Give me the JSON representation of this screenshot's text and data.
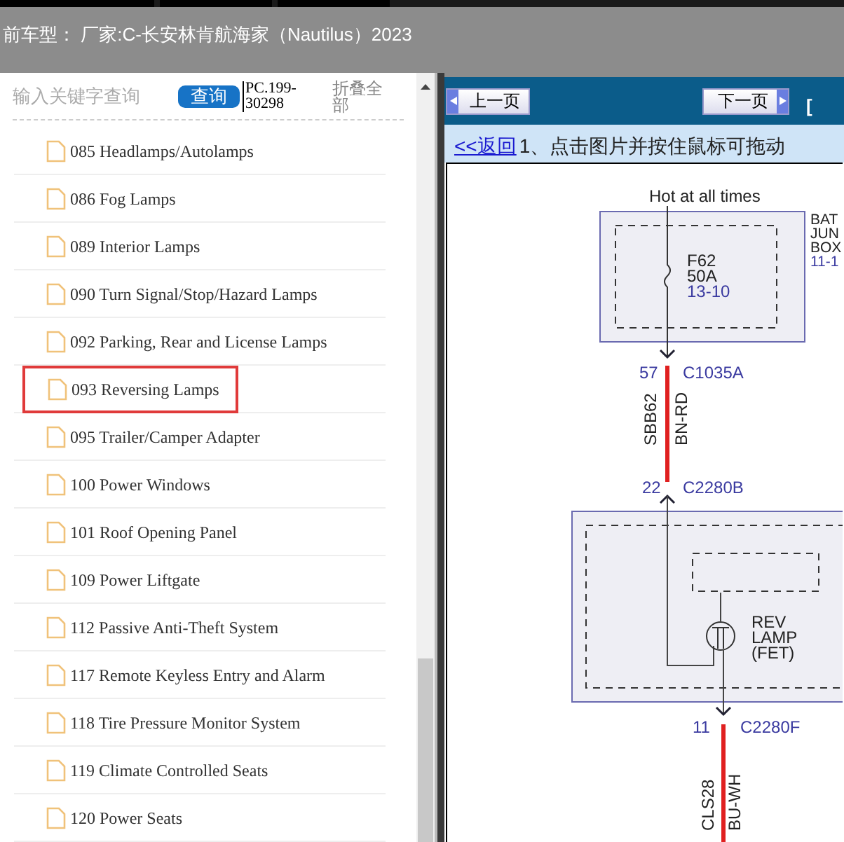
{
  "header": {
    "title": "前车型： 厂家:C-长安林肯航海家（Nautilus）2023"
  },
  "sidebar": {
    "search": {
      "placeholder": "输入关键字查询"
    },
    "query_button": "查询",
    "code": "PC.199-30298",
    "collapse_all": "折叠全部",
    "items": [
      {
        "label": "085 Headlamps/Autolamps",
        "highlighted": false
      },
      {
        "label": "086 Fog Lamps",
        "highlighted": false
      },
      {
        "label": "089 Interior Lamps",
        "highlighted": false
      },
      {
        "label": "090 Turn Signal/Stop/Hazard Lamps",
        "highlighted": false
      },
      {
        "label": "092 Parking, Rear and License Lamps",
        "highlighted": false
      },
      {
        "label": "093 Reversing Lamps",
        "highlighted": true
      },
      {
        "label": "095 Trailer/Camper Adapter",
        "highlighted": false
      },
      {
        "label": "100 Power Windows",
        "highlighted": false
      },
      {
        "label": "101 Roof Opening Panel",
        "highlighted": false
      },
      {
        "label": "109 Power Liftgate",
        "highlighted": false
      },
      {
        "label": "112 Passive Anti-Theft System",
        "highlighted": false
      },
      {
        "label": "117 Remote Keyless Entry and Alarm",
        "highlighted": false
      },
      {
        "label": "118 Tire Pressure Monitor System",
        "highlighted": false
      },
      {
        "label": "119 Climate Controlled Seats",
        "highlighted": false
      },
      {
        "label": "120 Power Seats",
        "highlighted": false
      }
    ]
  },
  "toolbar": {
    "prev_button": "上一页",
    "next_button": "下一页",
    "cut_text": "["
  },
  "info_bar": {
    "back_link": "<<返回",
    "instruction": "1、点击图片并按住鼠标可拖动"
  },
  "diagram": {
    "supply": "Hot at all times",
    "junction_box": [
      "BAT",
      "JUN",
      "BOX",
      "11-1"
    ],
    "fuse": [
      "F62",
      "50A",
      "13-10"
    ],
    "connectors": [
      {
        "pin": "57",
        "name": "C1035A"
      },
      {
        "pin": "22",
        "name": "C2280B"
      },
      {
        "pin": "11",
        "name": "C2280F"
      }
    ],
    "wires": [
      {
        "circuit": "SBB62",
        "color_code": "BN-RD"
      },
      {
        "circuit": "CLS28",
        "color_code": "BU-WH"
      }
    ],
    "lamp": [
      "REV",
      "LAMP",
      "(FET)"
    ]
  }
}
